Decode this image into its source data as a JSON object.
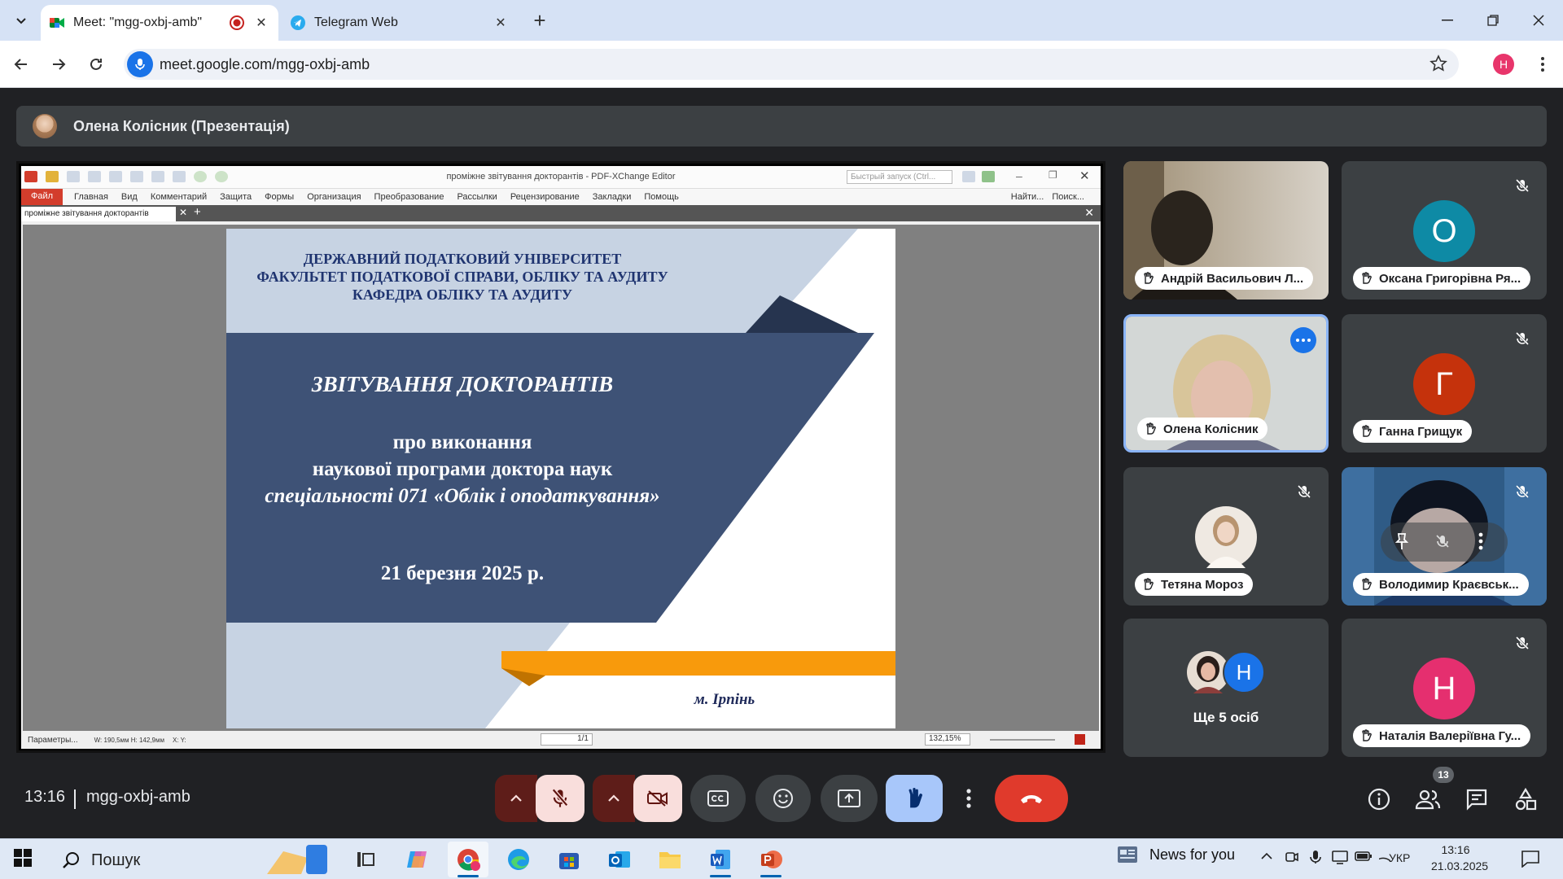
{
  "browser": {
    "tabs": [
      {
        "title": "Meet: \"mgg-oxbj-amb\"",
        "active": true,
        "recording": true
      },
      {
        "title": "Telegram Web",
        "active": false
      }
    ],
    "url": "meet.google.com/mgg-oxbj-amb",
    "profile_initial": "H"
  },
  "presenter_bar": {
    "name": "Олена Колісник (Презентація)"
  },
  "pdf_editor": {
    "window_title": "проміжне звітування докторантів - PDF-XChange Editor",
    "quick_launch_placeholder": "Быстрый запуск (Ctrl...",
    "menu": [
      "Файл",
      "Главная",
      "Вид",
      "Комментарий",
      "Защита",
      "Формы",
      "Организация",
      "Преобразование",
      "Рассылки",
      "Рецензирование",
      "Закладки",
      "Помощь"
    ],
    "menu_right": [
      "Найти...",
      "Поиск..."
    ],
    "doc_tab": "проміжне звітування докторантів",
    "status_params": "Параметры...",
    "status_dims": "W: 190,5мм  H: 142,9мм",
    "status_xy": "X: Y:",
    "page": "1/1",
    "zoom": "132,15%"
  },
  "slide": {
    "header": [
      "ДЕРЖАВНИЙ ПОДАТКОВИЙ УНІВЕРСИТЕТ",
      "ФАКУЛЬТЕТ ПОДАТКОВОЇ СПРАВИ, ОБЛІКУ ТА АУДИТУ",
      "КАФЕДРА ОБЛІКУ ТА АУДИТУ"
    ],
    "title": "ЗВІТУВАННЯ  ДОКТОРАНТІВ",
    "subtitle": [
      "про виконання",
      "наукової програми доктора наук",
      "спеціальності 071 «Облік і оподаткування»"
    ],
    "date": "21 березня 2025 р.",
    "city": "м. Ірпінь",
    "colors": {
      "dark": "#3e5276",
      "light": "#c7d3e3",
      "accent": "#f89a0c",
      "header_text": "#1f3470"
    }
  },
  "participants": [
    {
      "name": "Андрій Васильович Л...",
      "type": "video",
      "muted": false
    },
    {
      "name": "Оксана Григорівна Ря...",
      "type": "letter",
      "letter": "О",
      "color": "#0e8aa5",
      "muted": true
    },
    {
      "name": "Олена Колісник",
      "type": "video",
      "muted": false,
      "active": true
    },
    {
      "name": "Ганна Грищук",
      "type": "letter",
      "letter": "Г",
      "color": "#c5320c",
      "muted": true
    },
    {
      "name": "Тетяна Мороз",
      "type": "avatar",
      "muted": true
    },
    {
      "name": "Володимир Краєвськ...",
      "type": "video",
      "muted": true
    },
    {
      "name": "Ще 5 осіб",
      "type": "group",
      "letter": "Н",
      "color": "#1a73e8"
    },
    {
      "name": "Наталія Валеріївна Гу...",
      "type": "letter",
      "letter": "Н",
      "color": "#e52f6f",
      "muted": true
    }
  ],
  "controls": {
    "time": "13:16",
    "meeting_code": "mgg-oxbj-amb",
    "people_count": "13"
  },
  "taskbar": {
    "search_label": "Пошук",
    "news": "News for you",
    "language": "УКР",
    "time": "13:16",
    "date": "21.03.2025"
  }
}
